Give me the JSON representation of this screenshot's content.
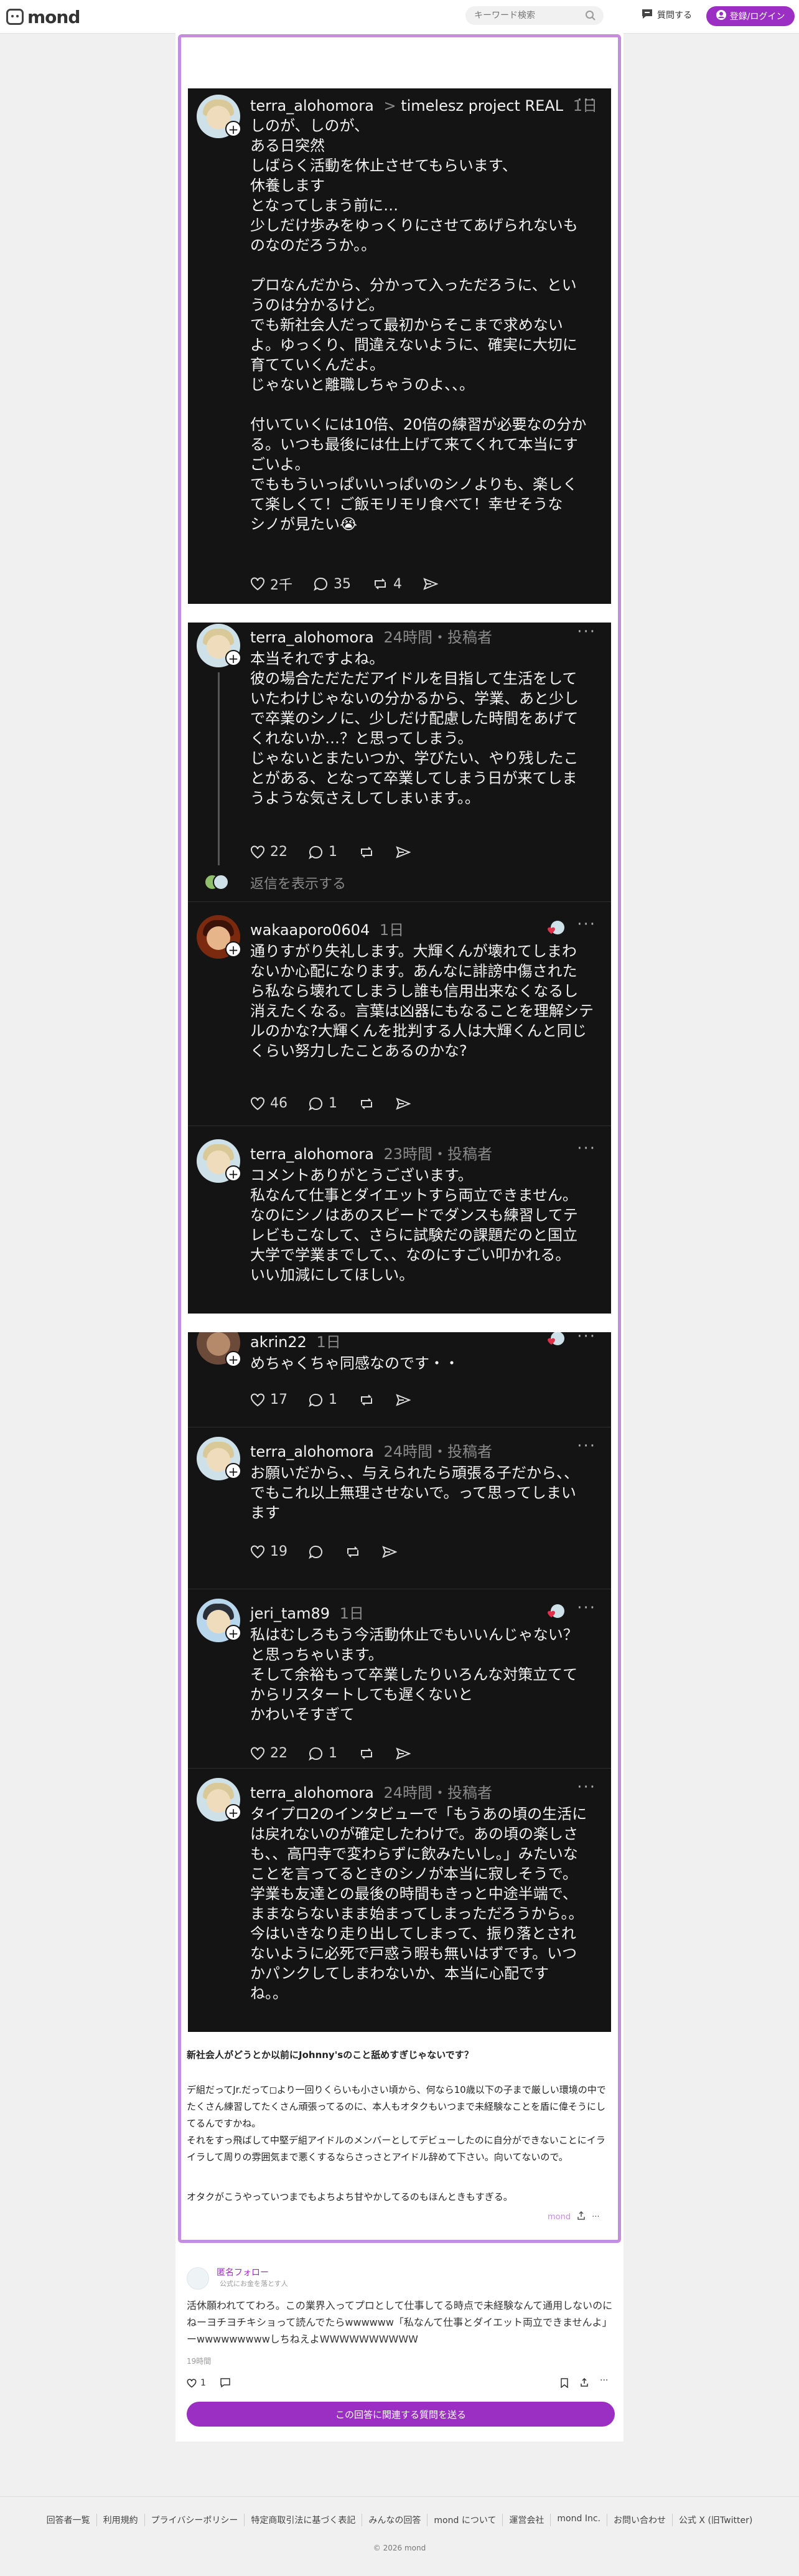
{
  "header": {
    "logo_text": "mond",
    "search_placeholder": "キーワード検索",
    "ask_label": "質問する",
    "login_label": "登録/ログイン"
  },
  "shot1": {
    "post": {
      "user": "terra_alohomora",
      "arrow": ">",
      "community": "timelesz project REAL",
      "time": "1日",
      "body": "しのが、しのが、\nある日突然\nしばらく活動を休止させてもらいます、\n休養します\nとなってしまう前に…\n少しだけ歩みをゆっくりにさせてあげられないも\nのなのだろうか。。\n\nプロなんだから、分かって入っただろうに、とい\nうのは分かるけど。\nでも新社会人だって最初からそこまで求めない\nよ。ゆっくり、間違えないように、確実に大切に\n育てていくんだよ。\nじゃないと離職しちゃうのよ、、。\n\n付いていくには10倍、20倍の練習が必要なの分か\nる。いつも最後には仕上げて来てくれて本当にす\nごいよ。\nでももういっぱいいっぱいのシノよりも、楽しく\nて楽しくて！ご飯モリモリ食べて！幸せそうな\nシノが見たい😭",
      "likes": "2千",
      "replies": "35",
      "reposts": "4"
    }
  },
  "shot2": {
    "reply1": {
      "user": "terra_alohomora",
      "meta": "24時間・投稿者",
      "body": "本当それですよね。\n彼の場合ただただアイドルを目指して生活をして\nいたわけじゃないの分かるから、学業、あと少し\nで卒業のシノに、少しだけ配慮した時間をあげて\nくれないか…？と思ってしまう。\nじゃないとまたいつか、学びたい、やり残したこ\nとがある、となって卒業してしまう日が来てしま\nうような気さえしてしまいます。。",
      "likes": "22",
      "replies": "1",
      "show_replies": "返信を表示する"
    },
    "reply2": {
      "user": "wakaaporo0604",
      "time": "1日",
      "body": "通りすがり失礼します。大輝くんが壊れてしまわ\nないか心配になります。あんなに誹謗中傷された\nら私なら壊れてしまうし誰も信用出来なくなるし\n消えたくなる。言葉は凶器にもなることを理解シテ\nルのかな?大輝くんを批判する人は大輝くんと同じ\nくらい努力したことあるのかな?",
      "likes": "46",
      "replies": "1"
    },
    "reply3": {
      "user": "terra_alohomora",
      "meta": "23時間・投稿者",
      "body": "コメントありがとうございます。\n私なんて仕事とダイエットすら両立できません。\nなのにシノはあのスピードでダンスも練習してテ\nレビもこなして、さらに試験だの課題だのと国立\n大学で学業までして、、なのにすごい叩かれる。\nいい加減にしてほしい。"
    }
  },
  "shot3": {
    "reply1": {
      "user": "akrin22",
      "time": "1日",
      "body": "めちゃくちゃ同感なのです・・",
      "likes": "17",
      "replies": "1"
    },
    "reply2": {
      "user": "terra_alohomora",
      "meta": "24時間・投稿者",
      "body": "お願いだから、、与えられたら頑張る子だから、、\nでもこれ以上無理させないで。って思ってしまい\nます",
      "likes": "19"
    },
    "reply3": {
      "user": "jeri_tam89",
      "time": "1日",
      "body": "私はむしろもう今活動休止でもいいんじゃない？\nと思っちゃいます。\nそして余裕もって卒業したりいろんな対策立てて\nからリスタートしても遅くないと\nかわいそすぎて",
      "likes": "22",
      "replies": "1"
    },
    "reply4": {
      "user": "terra_alohomora",
      "meta": "24時間・投稿者",
      "body": "タイプロ2のインタビューで「もうあの頃の生活に\nは戻れないのが確定したわけで。あの頃の楽しさ\nも、、高円寺で変わらずに飲みたいし。」みたいな\nことを言ってるときのシノが本当に寂しそうで。\n学業も友達との最後の時間もきっと中途半端で、\nままならないまま始まってしまっただろうから。。\n今はいきなり走り出してしまって、振り落とされ\nないように必死で戸惑う暇も無いはずです。いつ\nかパンクしてしまわないか、本当に心配です\nね。。"
    }
  },
  "question": {
    "heading": "新社会人がどうとか以前にJohnny'sのこと舐めすぎじゃないです？",
    "paragraph1": "デ組だってJr.だって◻︎より一回りくらいも小さい頃から、何なら10歳以下の子まで厳しい環境の中でたくさん練習してたくさん頑張ってるのに、本人もオタクもいつまで未経験なことを盾に偉そうにしてるんですかね。\nそれをすっ飛ばして中堅デ組アイドルのメンバーとしてデビューしたのに自分ができないことにイライラして周りの雰囲気まで悪くするならさっさとアイドル辞めて下さい。向いてないので。",
    "paragraph2": "オタクがこうやっていつまでもよちよち甘やかしてるのもほんときもすぎる。",
    "source": "mond"
  },
  "answer": {
    "follower_label": "匿名フォロー",
    "follower_sub": "公式にお金を落とす人",
    "text": "活休願われててわろ。この業界入ってプロとして仕事してる時点で未経験なんて通用しないのにねーヨチヨチキショって読んでたらwwwwww「私なんて仕事とダイエット両立できませんよ」ーwwwwwwwwwしちねえよWWWWWWWWWW",
    "time": "19時間",
    "likes": "1",
    "cta": "この回答に関連する質問を送る"
  },
  "footer": {
    "links": [
      "回答者一覧",
      "利用規約",
      "プライバシーポリシー",
      "特定商取引法に基づく表記",
      "みんなの回答",
      "mond について",
      "運営会社",
      "mond Inc.",
      "お問い合わせ",
      "公式 X (旧Twitter)"
    ],
    "copyright": "© 2026 mond"
  },
  "colors": {
    "brand": "#9b2fc4",
    "frame": "#c58ce0",
    "dark_bg": "#141414"
  }
}
